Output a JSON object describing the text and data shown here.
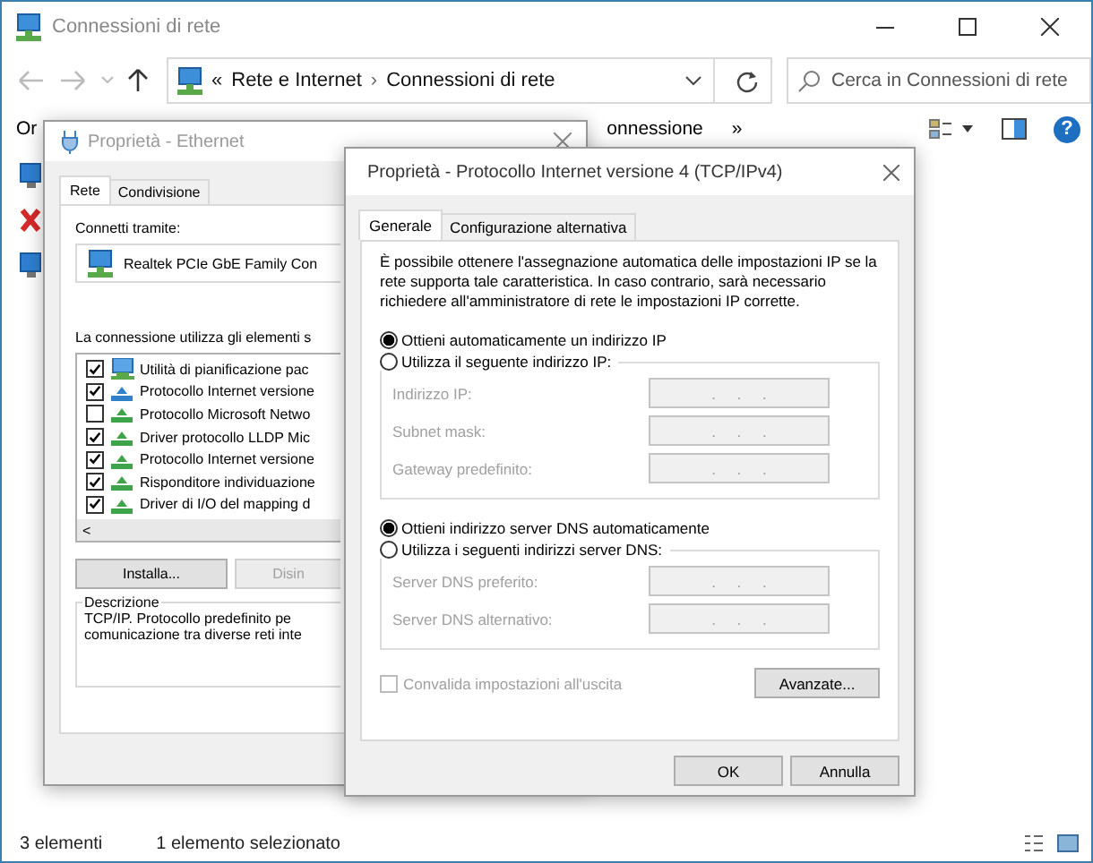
{
  "window": {
    "title": "Connessioni di rete"
  },
  "address_bar": {
    "overflow": "«",
    "path": [
      "Rete e Internet",
      "Connessioni di rete"
    ],
    "separator": "›"
  },
  "search": {
    "placeholder": "Cerca in Connessioni di rete"
  },
  "toolbar": {
    "items": [
      "Or",
      "onnessione"
    ],
    "overflow": "»",
    "help": "?"
  },
  "connections": [
    {
      "kind": "network"
    },
    {
      "kind": "disconnected"
    },
    {
      "kind": "network"
    }
  ],
  "status_bar": {
    "count": "3 elementi",
    "selection": "1 elemento selezionato"
  },
  "ethernet_dialog": {
    "title": "Proprietà - Ethernet",
    "tabs": [
      {
        "label": "Rete",
        "selected": true
      },
      {
        "label": "Condivisione",
        "selected": false
      }
    ],
    "connect_label": "Connetti tramite:",
    "adapter": "Realtek PCIe GbE Family Con",
    "items_label": "La connessione utilizza gli elementi s",
    "items": [
      {
        "label": "Utilità di pianificazione pac",
        "checked": true,
        "kind": "service"
      },
      {
        "label": "Protocollo Internet versione",
        "checked": true,
        "kind": "stack"
      },
      {
        "label": "Protocollo Microsoft Netwo",
        "checked": false,
        "kind": "protocol"
      },
      {
        "label": "Driver protocollo LLDP Mic",
        "checked": true,
        "kind": "protocol"
      },
      {
        "label": "Protocollo Internet versione",
        "checked": true,
        "kind": "protocol"
      },
      {
        "label": "Risponditore individuazione",
        "checked": true,
        "kind": "protocol"
      },
      {
        "label": "Driver di I/O del mapping d",
        "checked": true,
        "kind": "protocol"
      }
    ],
    "scroll_left": "<",
    "buttons": [
      {
        "label": "Installa...",
        "disabled": false
      },
      {
        "label": "Disin",
        "disabled": true
      }
    ],
    "description": {
      "title": "Descrizione",
      "lines": [
        "TCP/IP. Protocollo predefinito pe",
        "comunicazione tra diverse reti inte"
      ]
    }
  },
  "ipv4_dialog": {
    "title": "Proprietà - Protocollo Internet versione 4 (TCP/IPv4)",
    "tabs": [
      {
        "label": "Generale",
        "selected": true
      },
      {
        "label": "Configurazione alternativa",
        "selected": false
      }
    ],
    "intro": "È possibile ottenere l'assegnazione automatica delle impostazioni IP se la rete supporta tale caratteristica. In caso contrario, sarà necessario richiedere all'amministratore di rete le impostazioni IP corrette.",
    "ip_modes": [
      {
        "label": "Ottieni automaticamente un indirizzo IP",
        "selected": true
      },
      {
        "label": "Utilizza il seguente indirizzo IP:",
        "selected": false
      }
    ],
    "ip_fields": [
      {
        "label": "Indirizzo IP:",
        "value": ".     .     .",
        "disabled": true
      },
      {
        "label": "Subnet mask:",
        "value": ".     .     .",
        "disabled": true
      },
      {
        "label": "Gateway predefinito:",
        "value": ".     .     .",
        "disabled": true
      }
    ],
    "dns_modes": [
      {
        "label": "Ottieni indirizzo server DNS automaticamente",
        "selected": true
      },
      {
        "label": "Utilizza i seguenti indirizzi server DNS:",
        "selected": false
      }
    ],
    "dns_fields": [
      {
        "label": "Server DNS preferito:",
        "value": ".     .     .",
        "disabled": true
      },
      {
        "label": "Server DNS alternativo:",
        "value": ".     .     .",
        "disabled": true
      }
    ],
    "validate": {
      "label": "Convalida impostazioni all'uscita",
      "checked": false,
      "disabled": true
    },
    "advanced": "Avanzate...",
    "ok": "OK",
    "cancel": "Annulla"
  }
}
